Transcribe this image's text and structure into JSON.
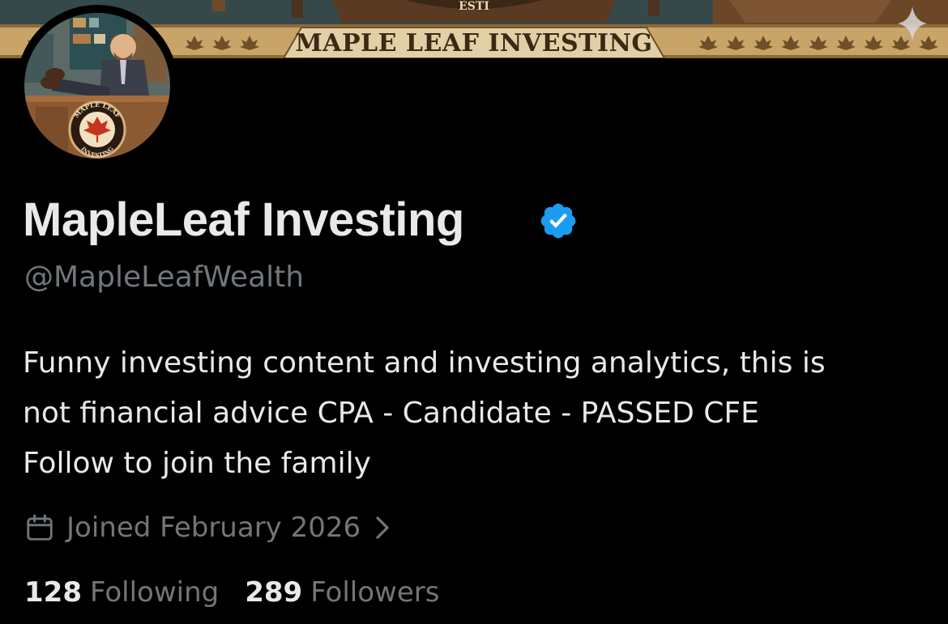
{
  "banner": {
    "title": "MAPLE LEAF INVESTING",
    "colors": {
      "ribbon": "#c9a468",
      "text": "#3a2a14",
      "background": "#334041"
    }
  },
  "profile": {
    "display_name": "MapleLeaf Investing",
    "verified": true,
    "verified_color": "#1d9bf0",
    "handle": "@MapleLeafWealth",
    "bio_lines": [
      "Funny investing content and investing analytics, this is",
      "not financial advice CPA - Candidate - PASSED CFE",
      "Follow to join the family"
    ],
    "joined": "Joined February 2026",
    "avatar_logo": {
      "line1": "MAPLE LEAF",
      "line2": "INVESTING"
    }
  },
  "stats": {
    "following": {
      "count": "128",
      "label": "Following"
    },
    "followers": {
      "count": "289",
      "label": "Followers"
    }
  },
  "icons": {
    "verified": "verified-badge-icon",
    "calendar": "calendar-icon",
    "chevron": "chevron-right-icon",
    "sparkle": "sparkle-icon"
  }
}
